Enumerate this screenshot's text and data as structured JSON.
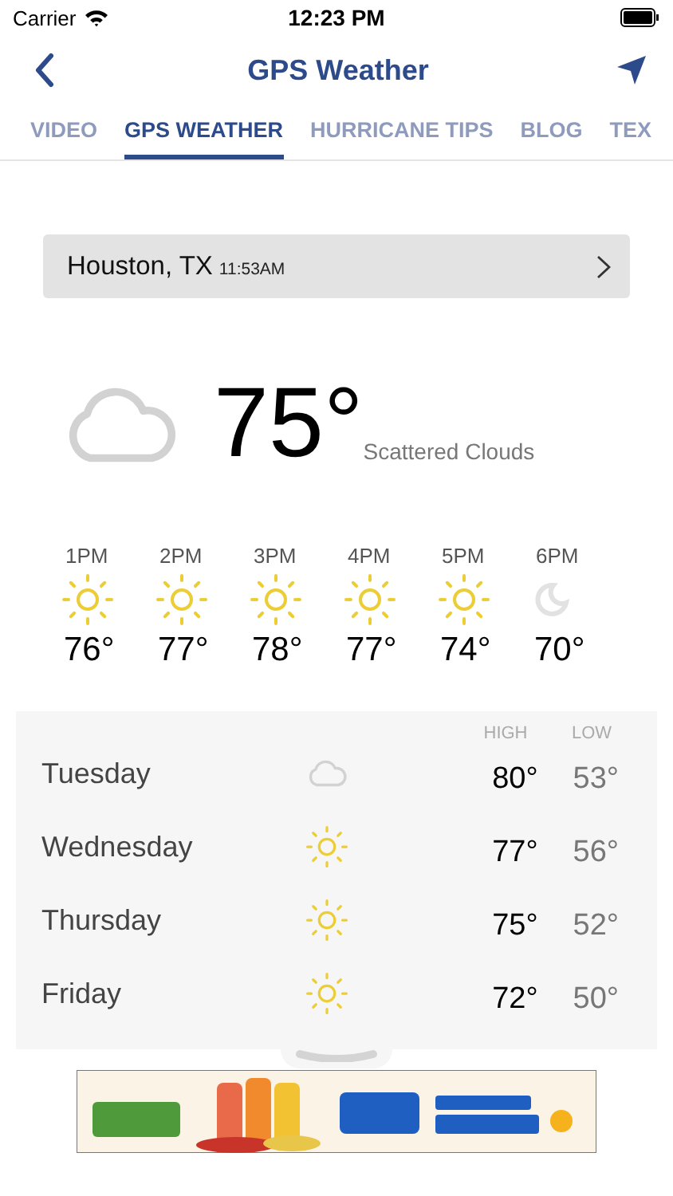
{
  "status_bar": {
    "carrier": "Carrier",
    "time": "12:23 PM"
  },
  "nav": {
    "title": "GPS Weather"
  },
  "tabs": [
    {
      "label": "VIDEO",
      "selected": false
    },
    {
      "label": "GPS WEATHER",
      "selected": true
    },
    {
      "label": "HURRICANE TIPS",
      "selected": false
    },
    {
      "label": "BLOG",
      "selected": false
    },
    {
      "label": "TEX",
      "selected": false
    }
  ],
  "location": {
    "city": "Houston, TX",
    "time": "11:53AM"
  },
  "current": {
    "kind": "cloud",
    "temperature": "75°",
    "condition": "Scattered Clouds"
  },
  "hourly": [
    {
      "time": "1PM",
      "kind": "sun",
      "temperature": "76°"
    },
    {
      "time": "2PM",
      "kind": "sun",
      "temperature": "77°"
    },
    {
      "time": "3PM",
      "kind": "sun",
      "temperature": "78°"
    },
    {
      "time": "4PM",
      "kind": "sun",
      "temperature": "77°"
    },
    {
      "time": "5PM",
      "kind": "sun",
      "temperature": "74°"
    },
    {
      "time": "6PM",
      "kind": "moon",
      "temperature": "70°"
    }
  ],
  "daily": {
    "columns": [
      "HIGH",
      "LOW"
    ],
    "rows": [
      {
        "day": "Tuesday",
        "kind": "cloud",
        "high": "80°",
        "low": "53°"
      },
      {
        "day": "Wednesday",
        "kind": "sun",
        "high": "77°",
        "low": "56°"
      },
      {
        "day": "Thursday",
        "kind": "sun",
        "high": "75°",
        "low": "52°"
      },
      {
        "day": "Friday",
        "kind": "sun",
        "high": "72°",
        "low": "50°"
      }
    ]
  }
}
